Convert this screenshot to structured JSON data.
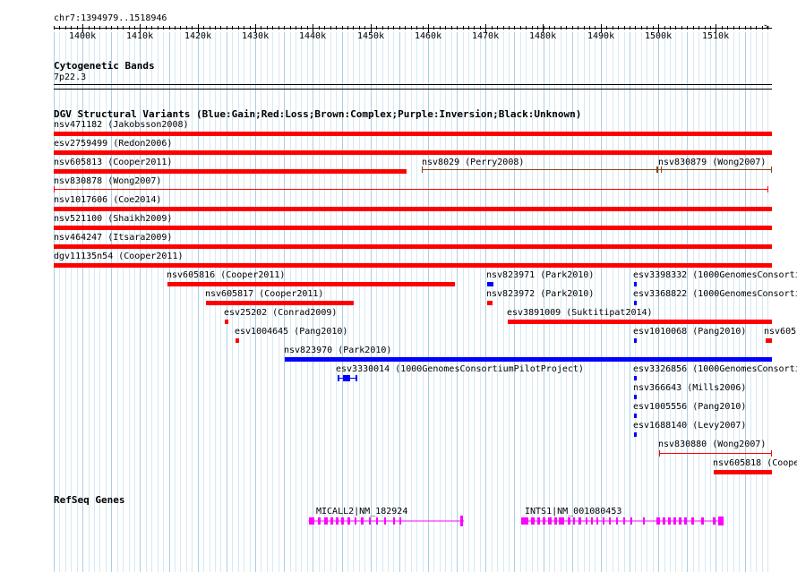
{
  "ruler": {
    "location": "chr7:1394979..1518946",
    "ticks": [
      "1400k",
      "1410k",
      "1420k",
      "1430k",
      "1440k",
      "1450k",
      "1460k",
      "1470k",
      "1480k",
      "1490k",
      "1500k",
      "1510k"
    ]
  },
  "tracks": {
    "cytoband": {
      "title": "Cytogenetic Bands",
      "band": "7p22.3"
    },
    "dgv": {
      "title": "DGV Structural Variants (Blue:Gain;Red:Loss;Brown:Complex;Purple:Inversion;Black:Unknown)",
      "colors": {
        "gain": "#0000ff",
        "loss": "#ff0000",
        "complex": "#8b4513",
        "inversion": "#800080",
        "unknown": "#000000"
      },
      "features": [
        {
          "id": "nsv471182 (Jakobsson2008)",
          "type": "loss"
        },
        {
          "id": "esv2759499 (Redon2006)",
          "type": "loss"
        },
        {
          "id": "nsv605813 (Cooper2011)",
          "type": "loss"
        },
        {
          "id": "nsv8029 (Perry2008)",
          "type": "complex"
        },
        {
          "id": "nsv830879 (Wong2007)",
          "type": "complex"
        },
        {
          "id": "nsv830878 (Wong2007)",
          "type": "loss"
        },
        {
          "id": "nsv1017606 (Coe2014)",
          "type": "loss"
        },
        {
          "id": "nsv521100 (Shaikh2009)",
          "type": "loss"
        },
        {
          "id": "nsv464247 (Itsara2009)",
          "type": "loss"
        },
        {
          "id": "dgv11135n54 (Cooper2011)",
          "type": "loss"
        },
        {
          "id": "nsv605816 (Cooper2011)",
          "type": "loss"
        },
        {
          "id": "nsv823971 (Park2010)",
          "type": "gain"
        },
        {
          "id": "esv3398332 (1000GenomesConsorti",
          "type": "gain"
        },
        {
          "id": "nsv605817 (Cooper2011)",
          "type": "loss"
        },
        {
          "id": "nsv823972 (Park2010)",
          "type": "loss"
        },
        {
          "id": "esv3368822 (1000GenomesConsorti",
          "type": "gain"
        },
        {
          "id": "esv25202 (Conrad2009)",
          "type": "loss"
        },
        {
          "id": "esv3891009 (Suktitipat2014)",
          "type": "loss"
        },
        {
          "id": "esv1004645 (Pang2010)",
          "type": "loss"
        },
        {
          "id": "esv1010068 (Pang2010)",
          "type": "gain"
        },
        {
          "id": "nsv605",
          "type": "loss"
        },
        {
          "id": "nsv823970 (Park2010)",
          "type": "gain"
        },
        {
          "id": "esv3330014 (1000GenomesConsortiumPilotProject)",
          "type": "gain"
        },
        {
          "id": "esv3326856 (1000GenomesConsorti",
          "type": "gain"
        },
        {
          "id": "nsv366643 (Mills2006)",
          "type": "gain"
        },
        {
          "id": "esv1005556 (Pang2010)",
          "type": "gain"
        },
        {
          "id": "esv1688140 (Levy2007)",
          "type": "gain"
        },
        {
          "id": "nsv830880 (Wong2007)",
          "type": "loss"
        },
        {
          "id": "nsv605818 (Coope",
          "type": "loss"
        }
      ]
    },
    "refseq": {
      "title": "RefSeq Genes",
      "color": "#ff00ff",
      "genes": [
        {
          "name": "MICALL2|NM_182924"
        },
        {
          "name": "INTS1|NM_001080453"
        }
      ]
    }
  }
}
